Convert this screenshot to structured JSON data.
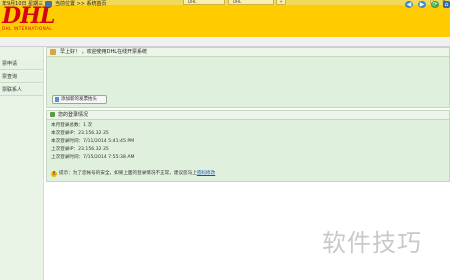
{
  "browser": {
    "tabs": [
      {
        "label": "DHL"
      },
      {
        "label": "DHL"
      }
    ],
    "new_tab": "+",
    "window_controls": {
      "minimize": "–",
      "maximize": "□",
      "close": "✕"
    }
  },
  "header": {
    "logo": "DHL",
    "logo_sub": "DHL INTERNATIONAL"
  },
  "toolbar": {
    "date": "年9月10日 星期三",
    "breadcrumb": "当前位置 >> 系统首页",
    "back": "◀",
    "forward": "▶",
    "refresh": "⟳",
    "home": "⌂"
  },
  "sidebar": {
    "items": [
      {
        "label": "票申请"
      },
      {
        "label": "票查询"
      },
      {
        "label": "票联系人"
      }
    ]
  },
  "welcome": {
    "text": "早上好！          ，欢迎使用DHL在线开票系统"
  },
  "bind_button": {
    "label": "添加新的发票抬头"
  },
  "login_info": {
    "title": "您的登录情况",
    "lines": [
      "本月登录总数：1 次",
      "本次登录IP：23.156.32.35",
      "本次登录时间：7/11/2014 5:41:45 PM",
      "上次登录IP：23.156.32.35",
      "上次登录时间：7/15/2014 7:55:38 AM"
    ]
  },
  "tip": {
    "icon": "!",
    "text": "提示：为了您帐号的安全，如果上面的登录情况不正常，建议您马上",
    "link": "密码修改"
  },
  "watermark": {
    "text": "软件技巧"
  }
}
